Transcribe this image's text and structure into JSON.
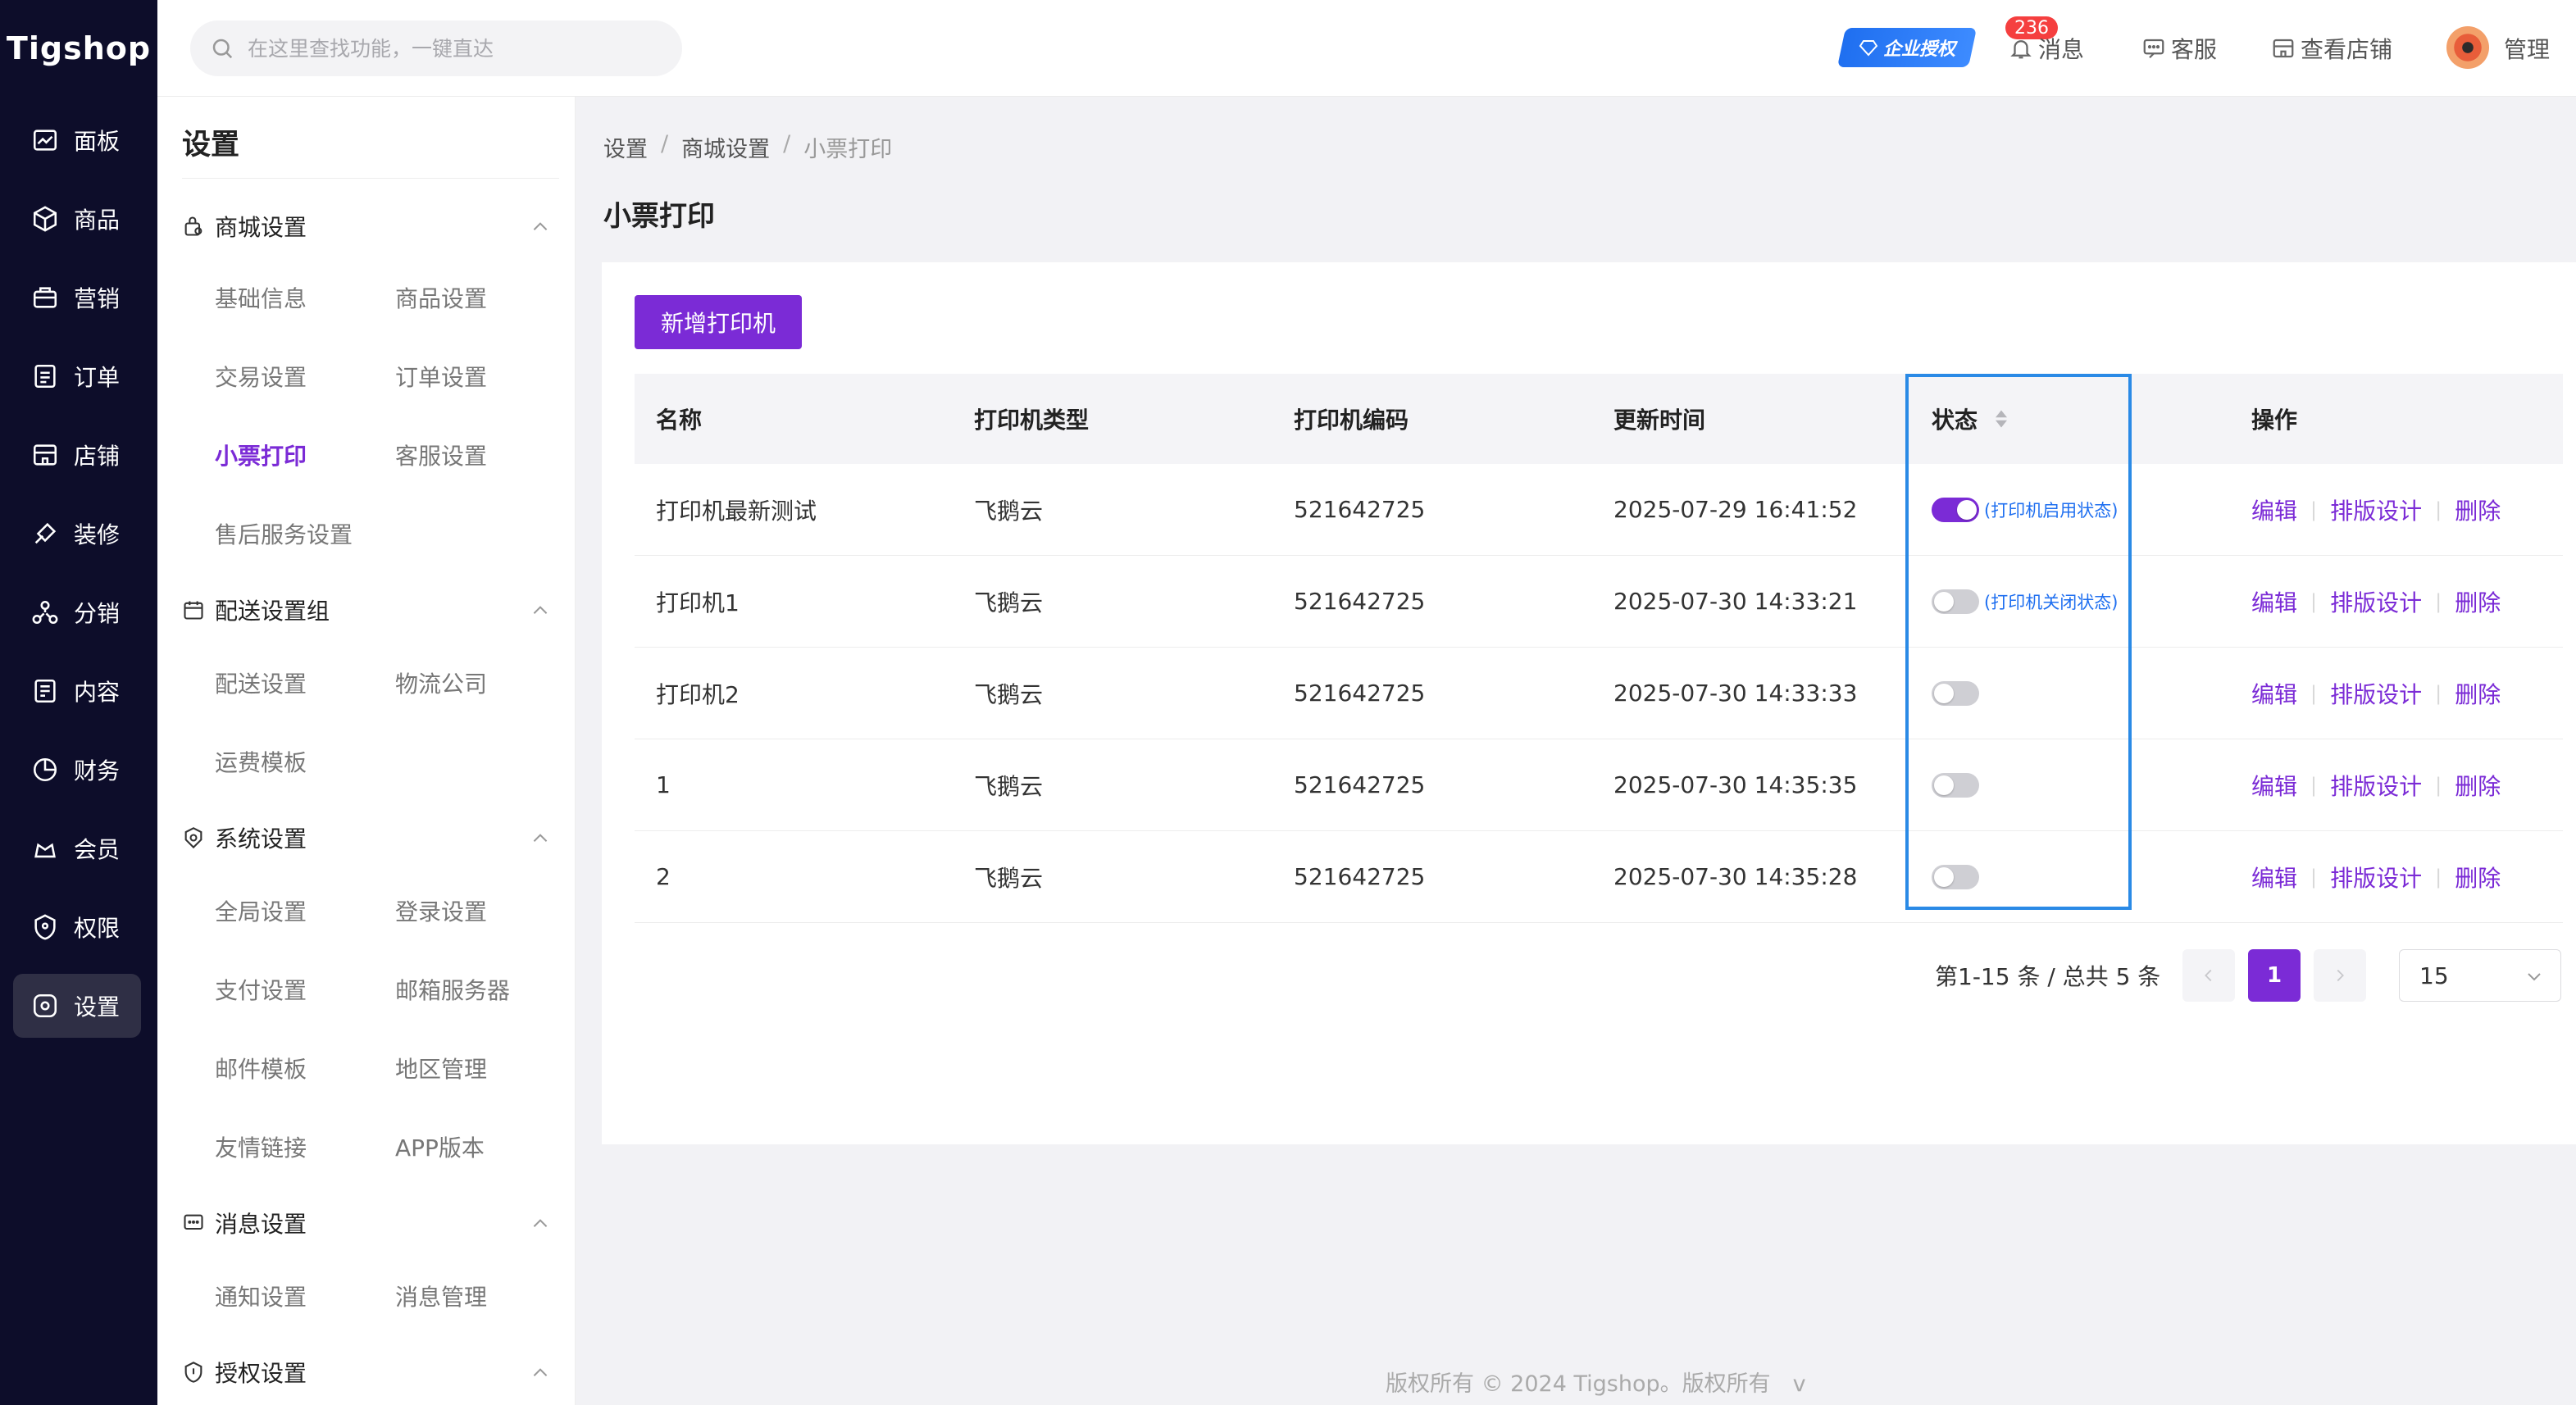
{
  "header": {
    "logo": "Tigshop",
    "search_placeholder": "在这里查找功能，一键直达",
    "enterprise_badge": "企业授权",
    "message_count": "236",
    "messages": "消息",
    "service": "客服",
    "view_store": "查看店铺",
    "user": "管理"
  },
  "rail": [
    {
      "label": "面板",
      "icon": "dashboard-icon"
    },
    {
      "label": "商品",
      "icon": "box-icon"
    },
    {
      "label": "营销",
      "icon": "marketing-icon"
    },
    {
      "label": "订单",
      "icon": "order-icon"
    },
    {
      "label": "店铺",
      "icon": "store-icon"
    },
    {
      "label": "装修",
      "icon": "decorate-icon"
    },
    {
      "label": "分销",
      "icon": "distribution-icon"
    },
    {
      "label": "内容",
      "icon": "content-icon"
    },
    {
      "label": "财务",
      "icon": "finance-icon"
    },
    {
      "label": "会员",
      "icon": "member-icon"
    },
    {
      "label": "权限",
      "icon": "permission-icon"
    },
    {
      "label": "设置",
      "icon": "settings-icon",
      "active": true
    }
  ],
  "subnav": {
    "title": "设置",
    "groups": [
      {
        "title": "商城设置",
        "links": [
          "基础信息",
          "商品设置",
          "交易设置",
          "订单设置",
          "小票打印",
          "客服设置",
          "售后服务设置"
        ]
      },
      {
        "title": "配送设置组",
        "links": [
          "配送设置",
          "物流公司",
          "运费模板"
        ]
      },
      {
        "title": "系统设置",
        "links": [
          "全局设置",
          "登录设置",
          "支付设置",
          "邮箱服务器",
          "邮件模板",
          "地区管理",
          "友情链接",
          "APP版本"
        ]
      },
      {
        "title": "消息设置",
        "links": [
          "通知设置",
          "消息管理"
        ]
      },
      {
        "title": "授权设置",
        "links": []
      }
    ],
    "active_link": "小票打印"
  },
  "breadcrumb": [
    "设置",
    "商城设置",
    "小票打印"
  ],
  "page_title": "小票打印",
  "add_button": "新增打印机",
  "table": {
    "columns": [
      "名称",
      "打印机类型",
      "打印机编码",
      "更新时间",
      "状态",
      "操作"
    ],
    "rows": [
      {
        "name": "打印机最新测试",
        "type": "飞鹅云",
        "code": "521642725",
        "updated": "2025-07-29 16:41:52",
        "enabled": true,
        "note": "(打印机启用状态)"
      },
      {
        "name": "打印机1",
        "type": "飞鹅云",
        "code": "521642725",
        "updated": "2025-07-30 14:33:21",
        "enabled": false,
        "note": "(打印机关闭状态)"
      },
      {
        "name": "打印机2",
        "type": "飞鹅云",
        "code": "521642725",
        "updated": "2025-07-30 14:33:33",
        "enabled": false,
        "note": ""
      },
      {
        "name": "1",
        "type": "飞鹅云",
        "code": "521642725",
        "updated": "2025-07-30 14:35:35",
        "enabled": false,
        "note": ""
      },
      {
        "name": "2",
        "type": "飞鹅云",
        "code": "521642725",
        "updated": "2025-07-30 14:35:28",
        "enabled": false,
        "note": ""
      }
    ],
    "actions": [
      "编辑",
      "排版设计",
      "删除"
    ]
  },
  "pagination": {
    "summary": "第1-15 条 / 总共 5 条",
    "current_page": "1",
    "page_size": "15"
  },
  "footer": "版权所有 © 2024 Tigshop。版权所有　v",
  "colors": {
    "accent": "#7b2bd6",
    "rail": "#0d0d2a",
    "highlight": "#2a8ae6",
    "link_note": "#1f6ff0"
  }
}
